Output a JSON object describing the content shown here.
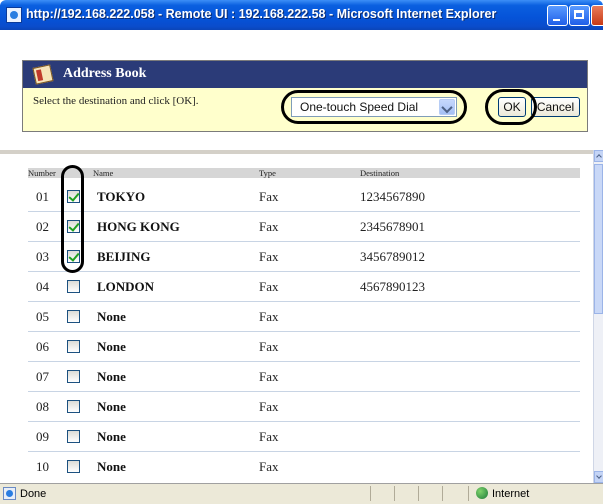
{
  "window": {
    "title": "http://192.168.222.058 - Remote UI : 192.168.222.58 - Microsoft Internet Explorer"
  },
  "address_book": {
    "title": "Address Book",
    "instruction": "Select the destination and click [OK].",
    "dropdown_value": "One-touch Speed Dial",
    "ok_label": "OK",
    "cancel_label": "Cancel"
  },
  "table": {
    "headers": [
      "Number",
      "",
      "Name",
      "Type",
      "Destination"
    ],
    "rows": [
      {
        "number": "01",
        "checked": true,
        "name": "TOKYO",
        "type": "Fax",
        "destination": "1234567890"
      },
      {
        "number": "02",
        "checked": true,
        "name": "HONG KONG",
        "type": "Fax",
        "destination": "2345678901"
      },
      {
        "number": "03",
        "checked": true,
        "name": "BEIJING",
        "type": "Fax",
        "destination": "3456789012"
      },
      {
        "number": "04",
        "checked": false,
        "name": "LONDON",
        "type": "Fax",
        "destination": "4567890123"
      },
      {
        "number": "05",
        "checked": false,
        "name": "None",
        "type": "Fax",
        "destination": ""
      },
      {
        "number": "06",
        "checked": false,
        "name": "None",
        "type": "Fax",
        "destination": ""
      },
      {
        "number": "07",
        "checked": false,
        "name": "None",
        "type": "Fax",
        "destination": ""
      },
      {
        "number": "08",
        "checked": false,
        "name": "None",
        "type": "Fax",
        "destination": ""
      },
      {
        "number": "09",
        "checked": false,
        "name": "None",
        "type": "Fax",
        "destination": ""
      },
      {
        "number": "10",
        "checked": false,
        "name": "None",
        "type": "Fax",
        "destination": ""
      }
    ]
  },
  "statusbar": {
    "status": "Done",
    "zone": "Internet"
  }
}
